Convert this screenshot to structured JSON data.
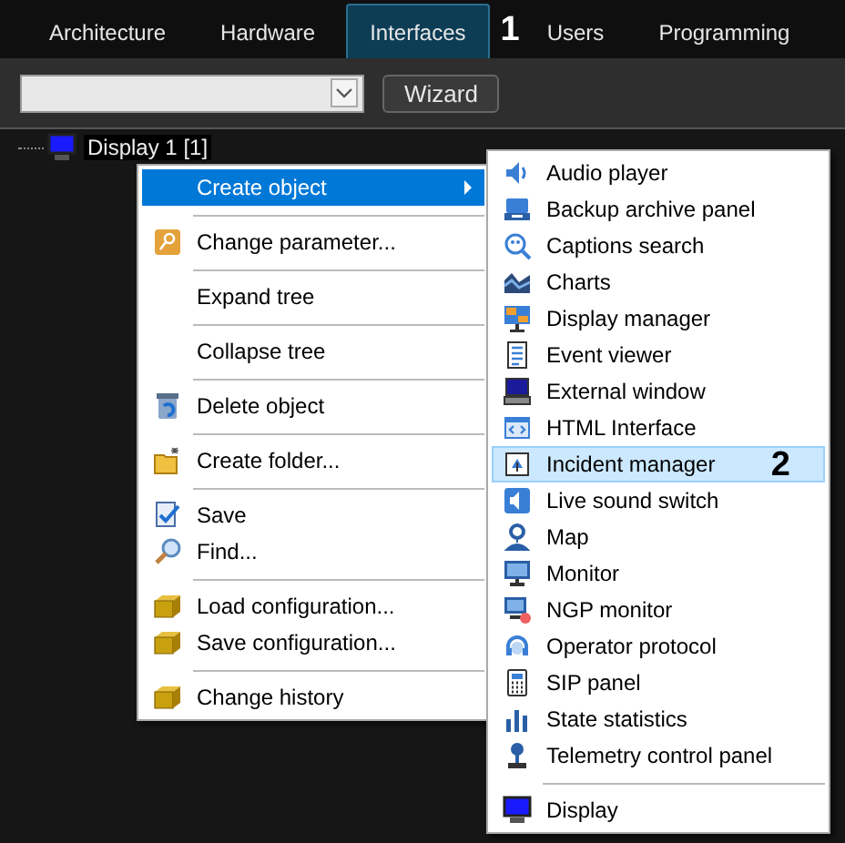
{
  "tabs": [
    {
      "label": "Architecture",
      "selected": false
    },
    {
      "label": "Hardware",
      "selected": false
    },
    {
      "label": "Interfaces",
      "selected": true
    },
    {
      "label": "Users",
      "selected": false
    },
    {
      "label": "Programming",
      "selected": false
    }
  ],
  "tab_callout": "1",
  "toolbar": {
    "wizard_button": "Wizard"
  },
  "tree": {
    "items": [
      {
        "label": "Display 1 [1]",
        "selected": true
      }
    ]
  },
  "context_menu": {
    "items": [
      {
        "kind": "item",
        "label": "Create object",
        "selected": true,
        "submenu": true
      },
      {
        "kind": "separator"
      },
      {
        "kind": "item",
        "label": "Change parameter...",
        "selected": false,
        "submenu": false
      },
      {
        "kind": "separator"
      },
      {
        "kind": "item",
        "label": "Expand tree",
        "selected": false,
        "submenu": false
      },
      {
        "kind": "separator"
      },
      {
        "kind": "item",
        "label": "Collapse tree",
        "selected": false,
        "submenu": false
      },
      {
        "kind": "separator"
      },
      {
        "kind": "item",
        "label": "Delete object",
        "selected": false,
        "submenu": false
      },
      {
        "kind": "separator"
      },
      {
        "kind": "item",
        "label": "Create folder...",
        "selected": false,
        "submenu": false
      },
      {
        "kind": "separator"
      },
      {
        "kind": "item",
        "label": "Save",
        "selected": false,
        "submenu": false
      },
      {
        "kind": "item",
        "label": "Find...",
        "selected": false,
        "submenu": false
      },
      {
        "kind": "separator"
      },
      {
        "kind": "item",
        "label": "Load configuration...",
        "selected": false,
        "submenu": false
      },
      {
        "kind": "item",
        "label": "Save configuration...",
        "selected": false,
        "submenu": false
      },
      {
        "kind": "separator"
      },
      {
        "kind": "item",
        "label": "Change history",
        "selected": false,
        "submenu": false
      }
    ]
  },
  "submenu": {
    "items": [
      {
        "kind": "item",
        "label": "Audio player",
        "selected": false
      },
      {
        "kind": "item",
        "label": "Backup archive panel",
        "selected": false
      },
      {
        "kind": "item",
        "label": "Captions search",
        "selected": false
      },
      {
        "kind": "item",
        "label": "Charts",
        "selected": false
      },
      {
        "kind": "item",
        "label": "Display manager",
        "selected": false
      },
      {
        "kind": "item",
        "label": "Event viewer",
        "selected": false
      },
      {
        "kind": "item",
        "label": "External window",
        "selected": false
      },
      {
        "kind": "item",
        "label": "HTML Interface",
        "selected": false
      },
      {
        "kind": "item",
        "label": "Incident manager",
        "selected": true,
        "callout": "2"
      },
      {
        "kind": "item",
        "label": "Live sound switch",
        "selected": false
      },
      {
        "kind": "item",
        "label": "Map",
        "selected": false
      },
      {
        "kind": "item",
        "label": "Monitor",
        "selected": false
      },
      {
        "kind": "item",
        "label": "NGP monitor",
        "selected": false
      },
      {
        "kind": "item",
        "label": "Operator protocol",
        "selected": false
      },
      {
        "kind": "item",
        "label": "SIP panel",
        "selected": false
      },
      {
        "kind": "item",
        "label": "State statistics",
        "selected": false
      },
      {
        "kind": "item",
        "label": "Telemetry control panel",
        "selected": false
      },
      {
        "kind": "separator"
      },
      {
        "kind": "item",
        "label": "Display",
        "selected": false
      }
    ]
  }
}
